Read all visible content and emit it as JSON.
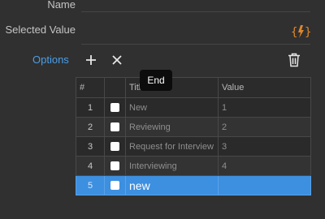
{
  "fields": {
    "name_label": "Name",
    "selected_value_label": "Selected Value",
    "options_label": "Options",
    "dynamic_value_icon": "lightning-bolt-icon",
    "accent_color": "#e0872b"
  },
  "toolbar": {
    "add_icon": "plus-icon",
    "remove_icon": "x-icon",
    "delete_icon": "trash-icon"
  },
  "tooltip": {
    "text": "End"
  },
  "table": {
    "headers": {
      "index": "#",
      "check": "",
      "title": "Title",
      "value": "Value"
    },
    "rows": [
      {
        "index": "1",
        "title": "New",
        "value": "1"
      },
      {
        "index": "2",
        "title": "Reviewing",
        "value": "2"
      },
      {
        "index": "3",
        "title": "Request for Interview",
        "value": "3"
      },
      {
        "index": "4",
        "title": "Interviewing",
        "value": "4"
      },
      {
        "index": "5",
        "title": "new",
        "value": ""
      }
    ],
    "selected_row": 5,
    "selected_color": "#3d8fe0"
  }
}
